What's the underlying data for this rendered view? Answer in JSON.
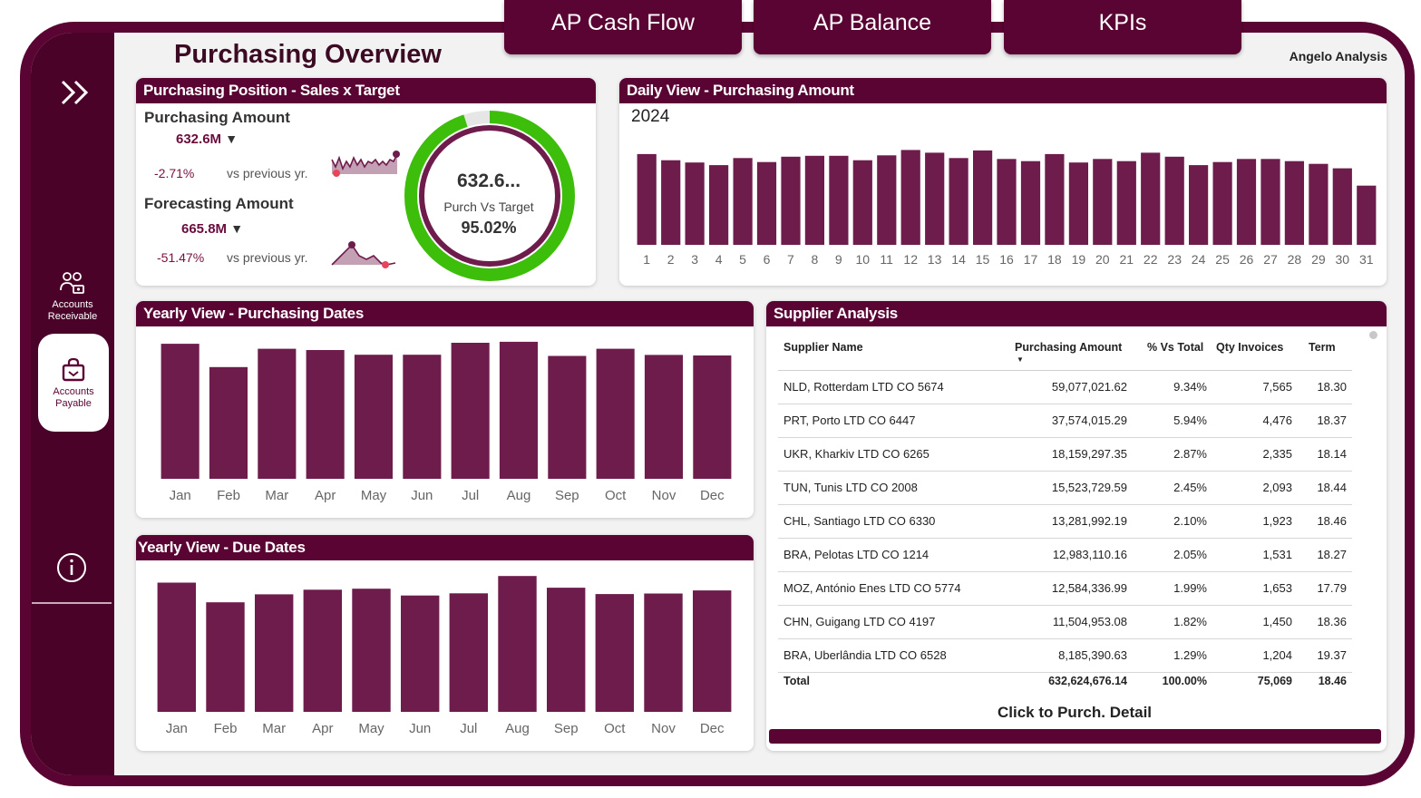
{
  "page": {
    "title": "Purchasing Overview",
    "brand": "Angelo Analysis"
  },
  "nav_tabs": [
    {
      "label": "AP Cash Flow"
    },
    {
      "label": "AP Balance"
    },
    {
      "label": "KPIs"
    }
  ],
  "sidebar": {
    "expand_icon": "double-chevron-right-icon",
    "items": [
      {
        "label_line1": "Accounts",
        "label_line2": "Receivable",
        "icon": "people-money-icon"
      },
      {
        "label_line1": "Accounts",
        "label_line2": "Payable",
        "icon": "shopping-bag-icon",
        "active": true
      }
    ],
    "info_icon": "info-circle-icon"
  },
  "position_card": {
    "title": "Purchasing Position - Sales x Target",
    "purchasing": {
      "label": "Purchasing Amount",
      "value": "632.6M",
      "change": "-2.71%",
      "vs": "vs previous yr."
    },
    "forecasting": {
      "label": "Forecasting Amount",
      "value": "665.8M",
      "change": "-51.47%",
      "vs": "vs previous yr."
    },
    "gauge": {
      "value": "632.6...",
      "label": "Purch Vs Target",
      "pct": "95.02%",
      "fraction": 0.9502
    }
  },
  "daily_card": {
    "title": "Daily View - Purchasing Amount",
    "year": "2024"
  },
  "yearly_purch_card": {
    "title": "Yearly View - Purchasing Dates"
  },
  "yearly_due_card": {
    "title": "Yearly View - Due Dates"
  },
  "supplier_card": {
    "title": "Supplier Analysis",
    "columns": [
      "Supplier Name",
      "Purchasing Amount",
      "% Vs Total",
      "Qty Invoices",
      "Term"
    ],
    "rows": [
      [
        "NLD, Rotterdam LTD CO 5674",
        "59,077,021.62",
        "9.34%",
        "7,565",
        "18.30"
      ],
      [
        "PRT, Porto LTD CO 6447",
        "37,574,015.29",
        "5.94%",
        "4,476",
        "18.37"
      ],
      [
        "UKR, Kharkiv LTD CO 6265",
        "18,159,297.35",
        "2.87%",
        "2,335",
        "18.14"
      ],
      [
        "TUN, Tunis LTD CO 2008",
        "15,523,729.59",
        "2.45%",
        "2,093",
        "18.44"
      ],
      [
        "CHL, Santiago LTD CO 6330",
        "13,281,992.19",
        "2.10%",
        "1,923",
        "18.46"
      ],
      [
        "BRA, Pelotas LTD CO 1214",
        "12,983,110.16",
        "2.05%",
        "1,531",
        "18.27"
      ],
      [
        "MOZ, António Enes LTD CO 5774",
        "12,584,336.99",
        "1.99%",
        "1,653",
        "17.79"
      ],
      [
        "CHN, Guigang LTD CO 4197",
        "11,504,953.08",
        "1.82%",
        "1,450",
        "18.36"
      ],
      [
        "BRA, Uberlândia LTD CO 6528",
        "8,185,390.63",
        "1.29%",
        "1,204",
        "19.37"
      ]
    ],
    "total": [
      "Total",
      "632,624,676.14",
      "100.00%",
      "75,069",
      "18.46"
    ],
    "detail_link": "Click to Purch. Detail"
  },
  "colors": {
    "brand": "#5a0433",
    "bar": "#6e1c4c",
    "gauge_green": "#3cbe0a",
    "sidebar": "#4a0229"
  },
  "chart_data": [
    {
      "type": "bar",
      "title": "Daily View - Purchasing Amount",
      "categories": [
        "1",
        "2",
        "3",
        "4",
        "5",
        "6",
        "7",
        "8",
        "9",
        "10",
        "11",
        "12",
        "13",
        "14",
        "15",
        "16",
        "17",
        "18",
        "19",
        "20",
        "21",
        "22",
        "23",
        "24",
        "25",
        "26",
        "27",
        "28",
        "29",
        "30",
        "31"
      ],
      "values": [
        20.4,
        19.0,
        18.5,
        17.9,
        19.5,
        18.6,
        19.8,
        20.0,
        20.0,
        19.0,
        20.1,
        21.3,
        20.7,
        19.5,
        21.2,
        19.3,
        18.8,
        20.4,
        18.5,
        19.3,
        18.8,
        20.7,
        19.8,
        17.9,
        18.6,
        19.3,
        19.3,
        18.8,
        18.2,
        17.2,
        13.3
      ],
      "unit": "M"
    },
    {
      "type": "bar",
      "title": "Yearly View - Purchasing Dates",
      "categories": [
        "Jan",
        "Feb",
        "Mar",
        "Apr",
        "May",
        "Jun",
        "Jul",
        "Aug",
        "Sep",
        "Oct",
        "Nov",
        "Dec"
      ],
      "values": [
        54.4,
        45.0,
        52.4,
        51.9,
        50.0,
        50.0,
        54.8,
        55.2,
        49.5,
        52.4,
        49.9,
        49.7
      ],
      "unit": "M"
    },
    {
      "type": "bar",
      "title": "Yearly View - Due Dates",
      "categories": [
        "Jan",
        "Feb",
        "Mar",
        "Apr",
        "May",
        "Jun",
        "Jul",
        "Aug",
        "Sep",
        "Oct",
        "Nov",
        "Dec"
      ],
      "values": [
        53.1,
        45.0,
        48.3,
        50.2,
        50.6,
        47.8,
        48.7,
        55.8,
        51.0,
        48.4,
        48.6,
        49.9
      ],
      "unit": "M"
    }
  ]
}
